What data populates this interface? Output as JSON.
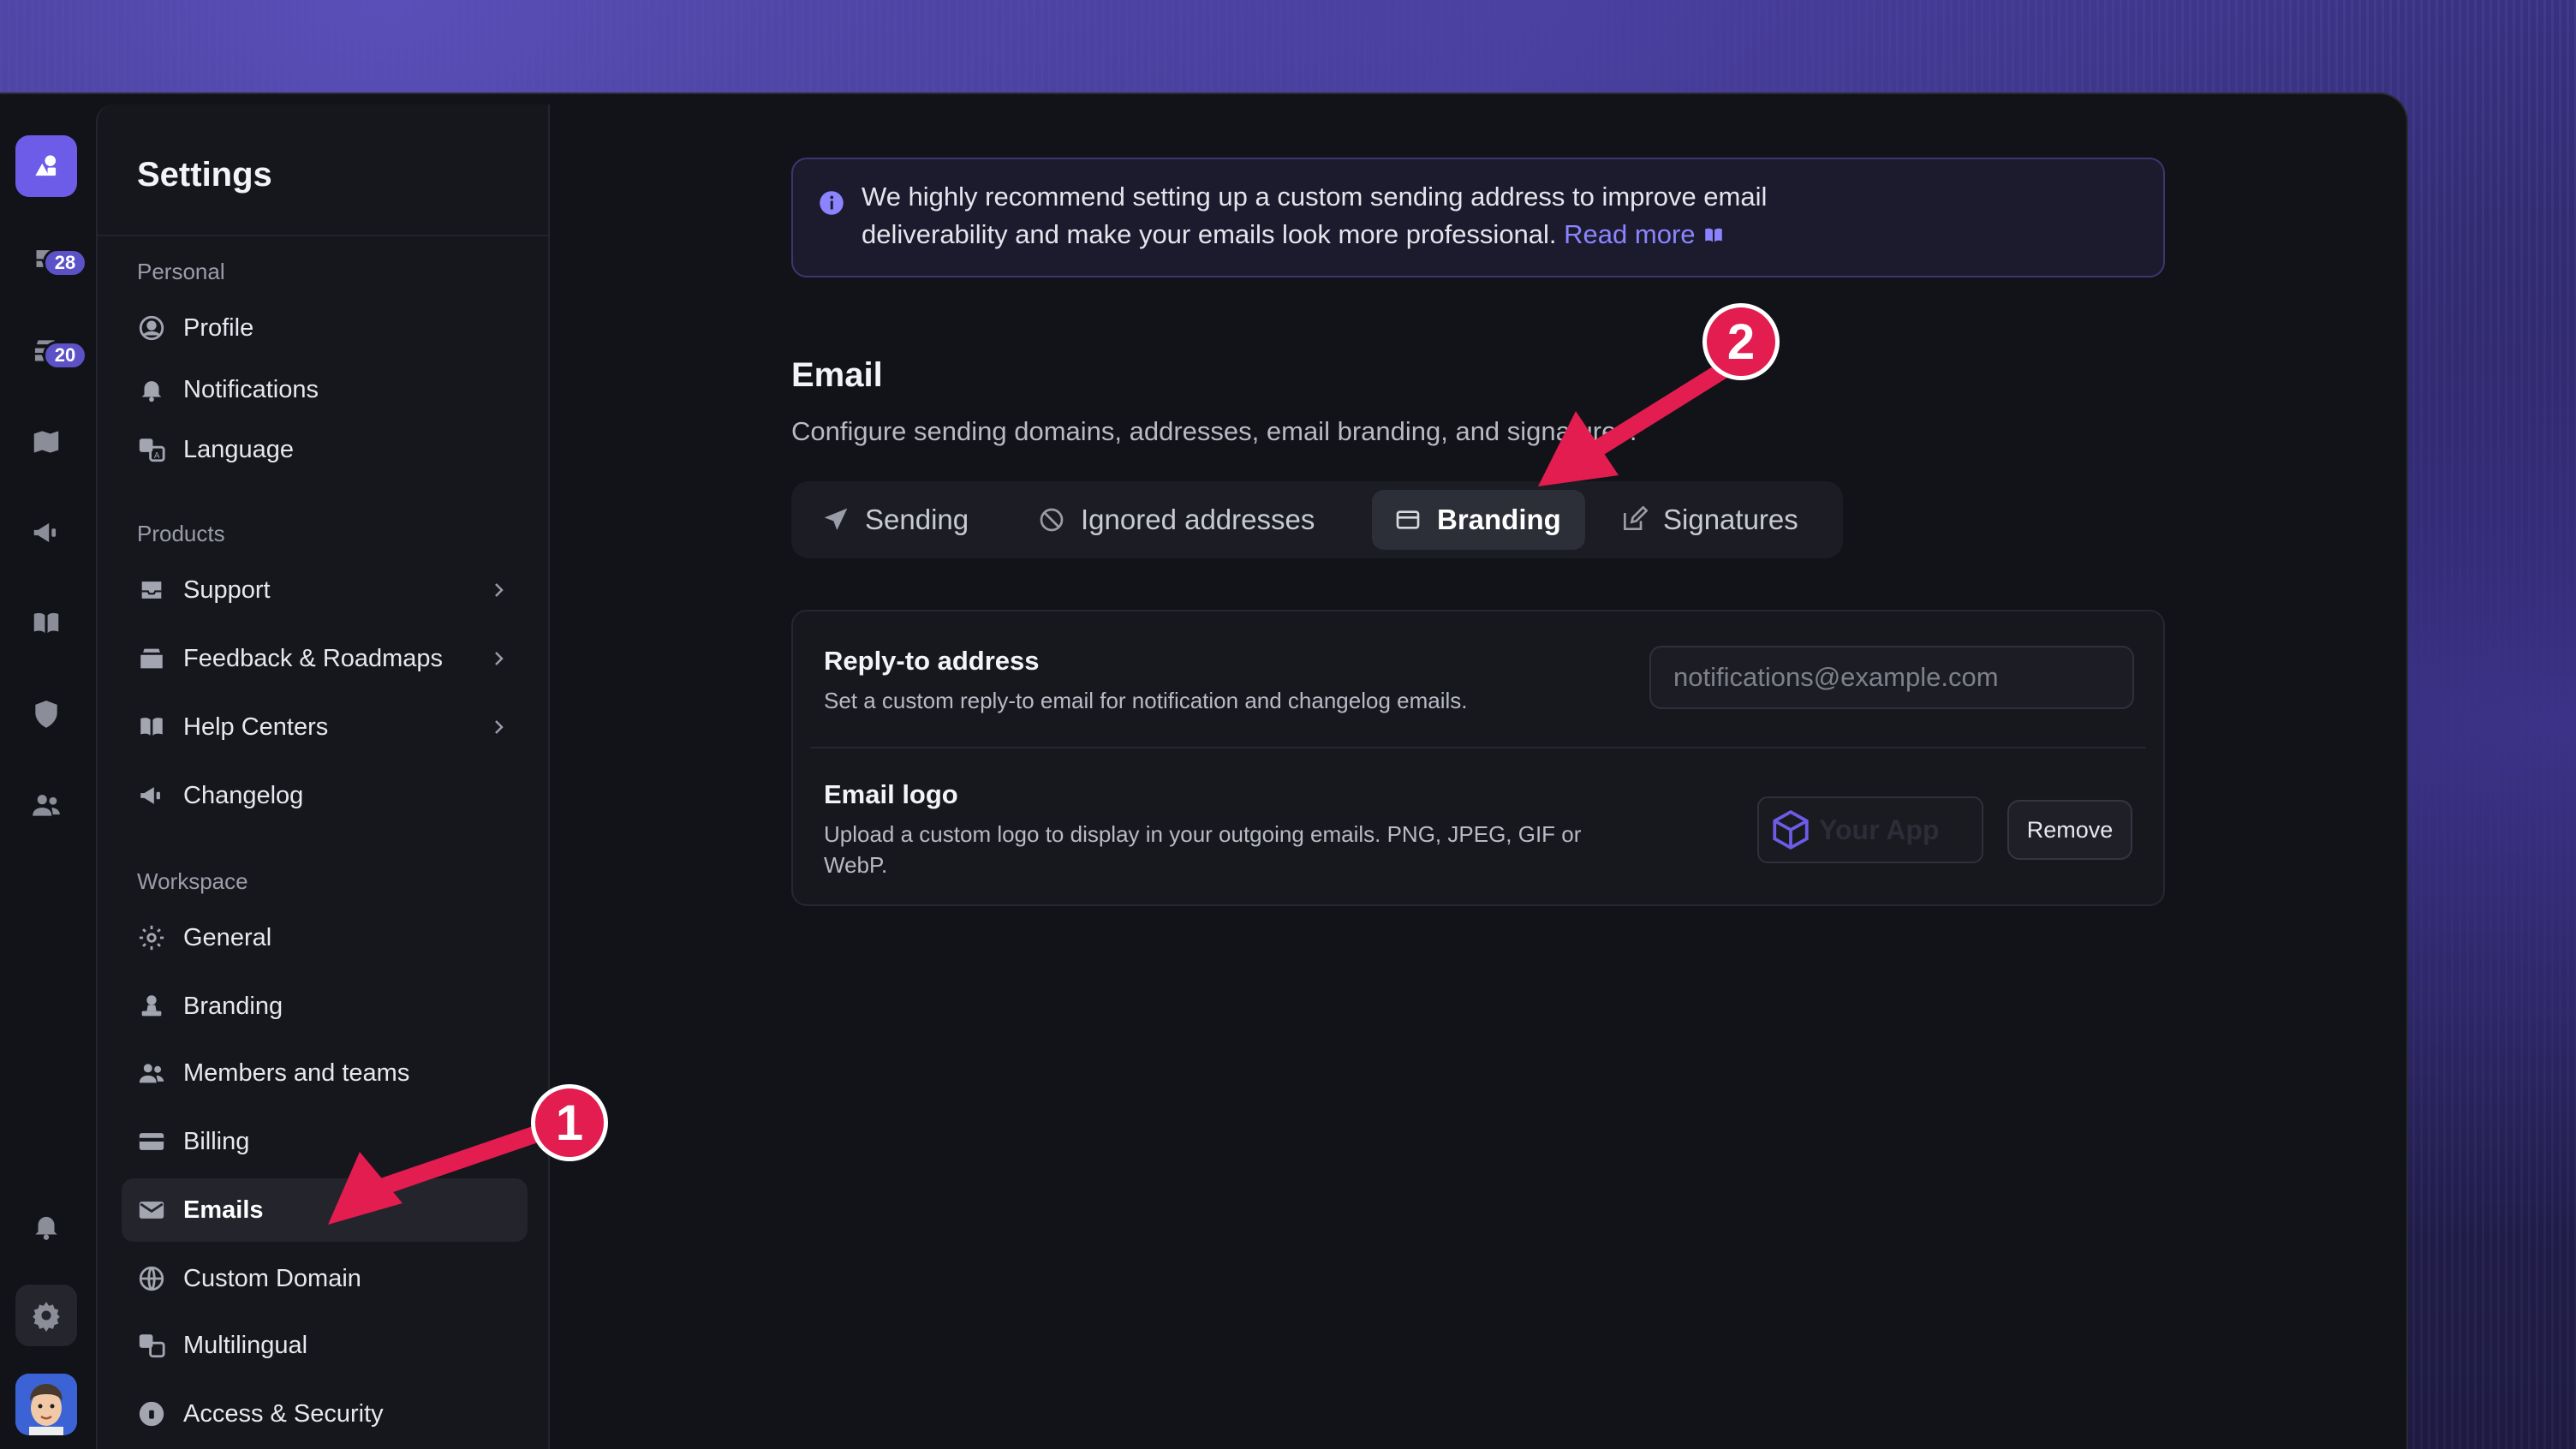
{
  "rail": {
    "badges": [
      "28",
      "20"
    ]
  },
  "panel": {
    "title": "Settings",
    "sections": {
      "personal": "Personal",
      "products": "Products",
      "workspace": "Workspace"
    },
    "items": {
      "profile": "Profile",
      "notifications": "Notifications",
      "language": "Language",
      "support": "Support",
      "feedback": "Feedback & Roadmaps",
      "help_centers": "Help Centers",
      "changelog": "Changelog",
      "general": "General",
      "branding": "Branding",
      "members": "Members and teams",
      "billing": "Billing",
      "emails": "Emails",
      "custom_domain": "Custom Domain",
      "multilingual": "Multilingual",
      "access": "Access & Security"
    }
  },
  "info": {
    "text": "We highly recommend setting up a custom sending address to improve email deliverability and make your emails look more professional.",
    "link": "Read more"
  },
  "email": {
    "title": "Email",
    "description": "Configure sending domains, addresses, email branding, and signatures."
  },
  "tabs": {
    "sending": "Sending",
    "ignored": "Ignored addresses",
    "branding": "Branding",
    "signatures": "Signatures"
  },
  "reply_to": {
    "title": "Reply-to address",
    "description": "Set a custom reply-to email for notification and changelog emails.",
    "placeholder": "notifications@example.com"
  },
  "email_logo": {
    "title": "Email logo",
    "description_line1": "Upload a custom logo to display in your outgoing emails. PNG, JPEG, GIF or",
    "description_line2": "WebP.",
    "logo_text": "Your App",
    "remove_label": "Remove"
  },
  "annotations": {
    "step1": "1",
    "step2": "2",
    "color": "#e31d4f"
  }
}
